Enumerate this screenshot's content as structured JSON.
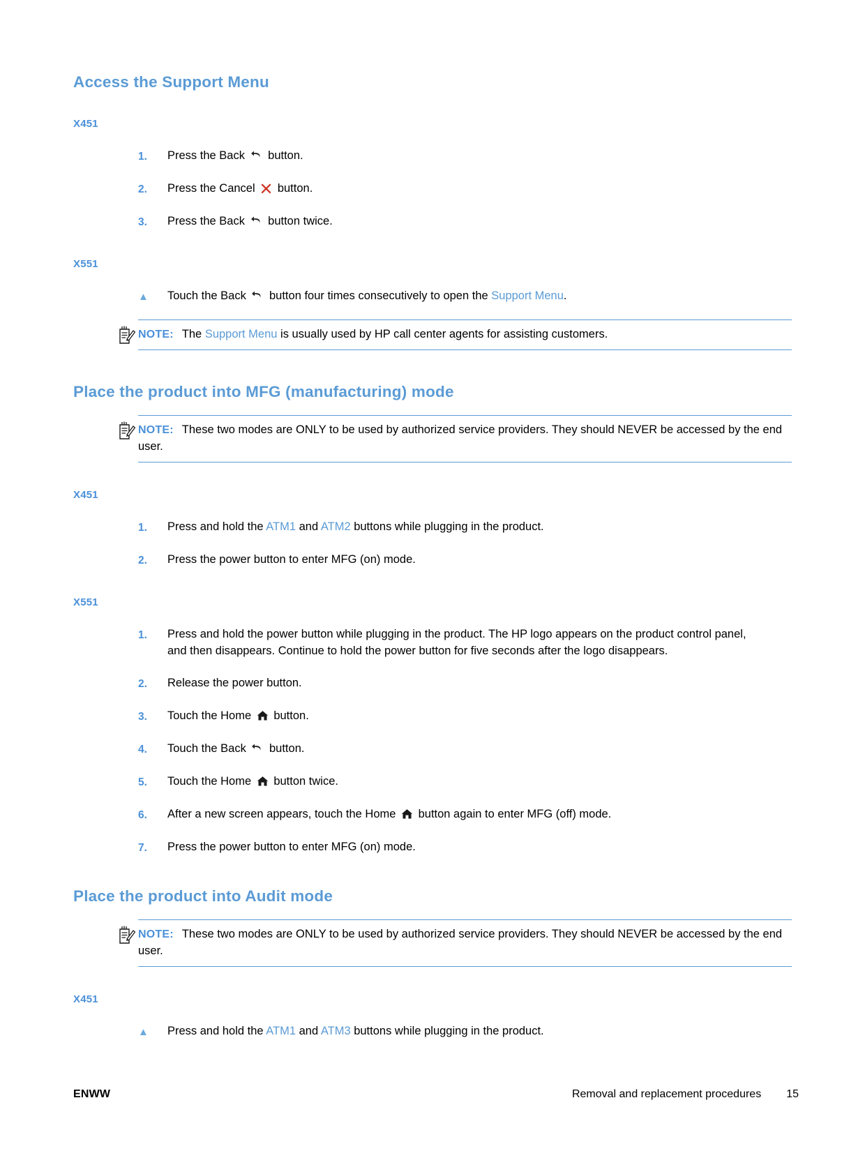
{
  "document": {
    "sections": [
      {
        "id": "access-support-menu",
        "title": "Access the Support Menu",
        "blocks": [
          {
            "type": "model-heading",
            "label": "X451"
          },
          {
            "type": "ordered-steps",
            "items": [
              {
                "marker": "1.",
                "pre": "Press the Back ",
                "icon": "back-icon",
                "post": " button."
              },
              {
                "marker": "2.",
                "pre": "Press the Cancel ",
                "icon": "cancel-icon",
                "post": " button."
              },
              {
                "marker": "3.",
                "pre": "Press the Back ",
                "icon": "back-icon",
                "post": " button twice."
              }
            ]
          },
          {
            "type": "model-heading",
            "label": "X551"
          },
          {
            "type": "bullet-steps",
            "items": [
              {
                "marker": "▲",
                "pre": "Touch the Back ",
                "icon": "back-icon",
                "post": " button four times consecutively to open the ",
                "term": "Support Menu",
                "tail": "."
              }
            ]
          },
          {
            "type": "note",
            "label": "NOTE:",
            "text_pre": "The ",
            "term": "Support Menu",
            "text_post": " is usually used by HP call center agents for assisting customers."
          }
        ]
      },
      {
        "id": "mfg-mode",
        "title": "Place the product into MFG (manufacturing) mode",
        "blocks": [
          {
            "type": "note",
            "label": "NOTE:",
            "text_pre": "These two modes are ONLY to be used by authorized service providers. They should NEVER be accessed by the end user.",
            "term": "",
            "text_post": ""
          },
          {
            "type": "model-heading",
            "label": "X451"
          },
          {
            "type": "ordered-steps",
            "items": [
              {
                "marker": "1.",
                "pre": "Press and hold the ",
                "term1": "ATM1",
                "mid": " and ",
                "term2": "ATM2",
                "post": " buttons while plugging in the product."
              },
              {
                "marker": "2.",
                "pre": "Press the power button to enter MFG (on) mode.",
                "post": ""
              }
            ]
          },
          {
            "type": "model-heading",
            "label": "X551"
          },
          {
            "type": "ordered-steps",
            "items": [
              {
                "marker": "1.",
                "pre": "Press and hold the power button while plugging in the product. The HP logo appears on the product control panel, and then disappears. Continue to hold the power button for five seconds after the logo disappears.",
                "post": ""
              },
              {
                "marker": "2.",
                "pre": "Release the power button.",
                "post": ""
              },
              {
                "marker": "3.",
                "pre": "Touch the Home ",
                "icon": "home-icon",
                "post": " button."
              },
              {
                "marker": "4.",
                "pre": "Touch the Back ",
                "icon": "back-icon",
                "post": " button."
              },
              {
                "marker": "5.",
                "pre": "Touch the Home ",
                "icon": "home-icon",
                "post": " button twice."
              },
              {
                "marker": "6.",
                "pre": "After a new screen appears, touch the Home ",
                "icon": "home-icon",
                "post": " button again to enter MFG (off) mode."
              },
              {
                "marker": "7.",
                "pre": "Press the power button to enter MFG (on) mode.",
                "post": ""
              }
            ]
          }
        ]
      },
      {
        "id": "audit-mode",
        "title": "Place the product into Audit mode",
        "blocks": [
          {
            "type": "note",
            "label": "NOTE:",
            "text_pre": "These two modes are ONLY to be used by authorized service providers. They should NEVER be accessed by the end user.",
            "term": "",
            "text_post": ""
          },
          {
            "type": "model-heading",
            "label": "X451"
          },
          {
            "type": "bullet-steps",
            "items": [
              {
                "marker": "▲",
                "pre": "Press and hold the ",
                "term1": "ATM1",
                "mid": " and ",
                "term2": "ATM3",
                "post": " buttons while plugging in the product."
              }
            ]
          }
        ]
      }
    ]
  },
  "footer": {
    "locale": "ENWW",
    "breadcrumb": "Removal and replacement procedures",
    "page_number": "15"
  },
  "colors": {
    "heading_blue": "#5b9bd5",
    "subheading_blue": "#4a90d9",
    "note_rule": "#5b9bd5",
    "cancel_red": "#cc3322",
    "text_black": "#000000"
  },
  "icons": {
    "back": "back-arrow-icon",
    "home": "home-icon",
    "cancel": "cancel-x-icon",
    "note": "note-clipboard-icon",
    "bullet": "triangle-bullet-icon"
  }
}
